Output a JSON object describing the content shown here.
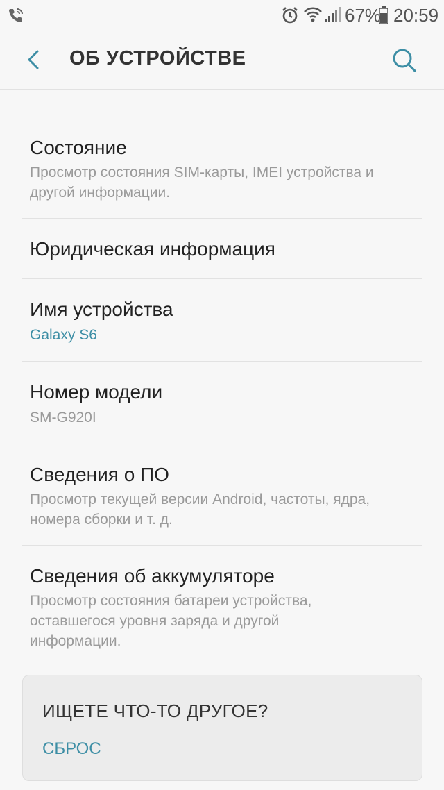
{
  "status_bar": {
    "battery_percent": "67%",
    "time": "20:59",
    "icons": [
      "phone-call-icon",
      "alarm-icon",
      "wifi-icon",
      "signal-icon",
      "battery-icon"
    ]
  },
  "header": {
    "title": "ОБ УСТРОЙСТВЕ",
    "back_icon": "back-arrow-icon",
    "search_icon": "search-icon"
  },
  "items": [
    {
      "title": "Состояние",
      "subtitle": "Просмотр состояния SIM-карты, IMEI устройства и другой информации."
    },
    {
      "title": "Юридическая информация",
      "subtitle": ""
    },
    {
      "title": "Имя устройства",
      "subtitle": "Galaxy S6"
    },
    {
      "title": "Номер модели",
      "subtitle": "SM-G920I"
    },
    {
      "title": "Сведения о ПО",
      "subtitle": "Просмотр текущей версии Android, частоты, ядра, номера сборки и т. д."
    },
    {
      "title": "Сведения об аккумуляторе",
      "subtitle": "Просмотр состояния батареи устройства, оставшегося уровня заряда и другой информации."
    }
  ],
  "suggest": {
    "title": "ИЩЕТЕ ЧТО-ТО ДРУГОЕ?",
    "link": "СБРОС"
  },
  "colors": {
    "accent": "#3d8ea5",
    "background": "#f7f7f7",
    "card": "#ececec"
  }
}
